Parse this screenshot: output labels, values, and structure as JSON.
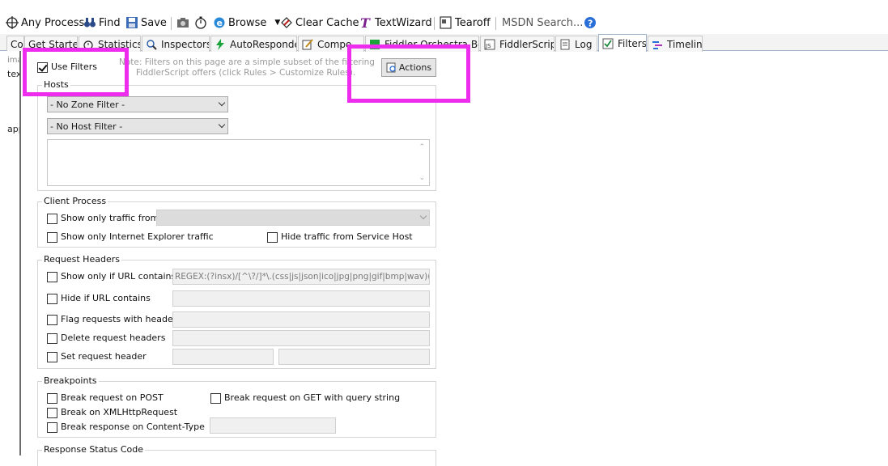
{
  "toolbar": {
    "any_process": "Any Process",
    "find": "Find",
    "save": "Save",
    "browse": "Browse",
    "clear_cache": "Clear Cache",
    "textwizard": "TextWizard",
    "tearoff": "Tearoff",
    "msdn_search": "MSDN Search..."
  },
  "tabs": [
    {
      "label": "Co"
    },
    {
      "label": "Get Started"
    },
    {
      "label": "Statistics"
    },
    {
      "label": "Inspectors"
    },
    {
      "label": "AutoResponder"
    },
    {
      "label": "Compo"
    },
    {
      "label": "Fiddler Orchestra Beta"
    },
    {
      "label": "FiddlerScript"
    },
    {
      "label": "Log"
    },
    {
      "label": "Filters"
    },
    {
      "label": "Timeline"
    }
  ],
  "left_strip": {
    "line1": "ima",
    "line2": "tex",
    "line3": "app"
  },
  "filters": {
    "use_filters_label": "Use Filters",
    "use_filters_checked": true,
    "note_line1": "Note: Filters on this page are a simple subset of the filtering",
    "note_line2": "FiddlerScript offers (click Rules > Customize Rules).",
    "actions_label": "Actions"
  },
  "hosts": {
    "title": "Hosts",
    "zone_filter": "- No Zone Filter -",
    "host_filter": "- No Host Filter -"
  },
  "client_process": {
    "title": "Client Process",
    "show_only_traffic_from": "Show only traffic from",
    "show_only_ie": "Show only Internet Explorer traffic",
    "hide_service_host": "Hide traffic from Service Host"
  },
  "request_headers": {
    "title": "Request Headers",
    "show_only_if_url": "Show only if URL contains",
    "url_regex": "REGEX:(?insx)/[^\\?/]*\\.(css|js|json|ico|jpg|png|gif|bmp|wav)(\\?.",
    "hide_if_url": "Hide if URL contains",
    "flag_requests": "Flag requests with headers",
    "delete_headers": "Delete request headers",
    "set_header": "Set request header"
  },
  "breakpoints": {
    "title": "Breakpoints",
    "break_post": "Break request on POST",
    "break_get_query": "Break request on GET with query string",
    "break_xhr": "Break on XMLHttpRequest",
    "break_response_ct": "Break response on Content-Type"
  },
  "response_status": {
    "title": "Response Status Code"
  },
  "colors": {
    "highlight": "#ee2cee",
    "tab_border": "#9fb3c8"
  }
}
